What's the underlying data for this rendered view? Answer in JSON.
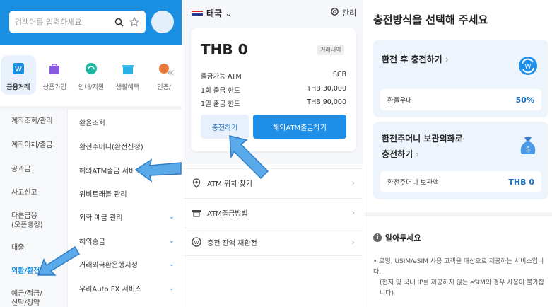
{
  "left": {
    "search_placeholder": "검색어를 입력하세요",
    "categories": [
      {
        "label": "금융거래",
        "icon": "finance-icon"
      },
      {
        "label": "상품가입",
        "icon": "bag-icon"
      },
      {
        "label": "안내/지원",
        "icon": "headset-icon"
      },
      {
        "label": "생활혜택",
        "icon": "gift-icon"
      },
      {
        "label": "인증/",
        "icon": "cert-icon"
      }
    ],
    "main_menu": [
      "계좌조회/관리",
      "계좌이체/출금",
      "공과금",
      "사고신고",
      "다른금융\n(오픈뱅킹)",
      "대출",
      "외환/환전",
      "예금/적금/\n신탁/청약"
    ],
    "sub_menu": [
      "환율조회",
      "환전주머니(환전신청)",
      "해외ATM출금 서비스",
      "위비트래블 관리",
      "외화 예금 관리",
      "해외송금",
      "거래외국환은행지정",
      "우리Auto FX 서비스"
    ]
  },
  "middle": {
    "country": "태국",
    "settings_label": "관리",
    "balance": "THB 0",
    "history_label": "거래내역",
    "rows": [
      {
        "label": "출금가능 ATM",
        "value": "SCB"
      },
      {
        "label": "1회 출금 한도",
        "value": "THB 30,000"
      },
      {
        "label": "1일 출금 한도",
        "value": "THB 90,000"
      }
    ],
    "charge_button": "충전하기",
    "withdraw_button": "해외ATM출금하기",
    "menu": [
      "ATM 위치 찾기",
      "ATM출금방법",
      "충전 잔액 재환전"
    ]
  },
  "right": {
    "title": "충전방식을 선택해 주세요",
    "option1_title": "환전 후 충전하기",
    "option1_label": "환율우대",
    "option1_value": "50%",
    "option2_title_line1": "환전주머니 보관외화로",
    "option2_title_line2": "충전하기",
    "option2_label": "환전주머니 보관액",
    "option2_value": "THB 0",
    "notice_title": "알아두세요",
    "notice_body": "로밍, USIM/eSIM 사용 고객을 대상으로 제공하는 서비스입니다.",
    "notice_sub": "(현지 및 국내 IP를 제공하지 않는 eSIM의 경우 사용이 불가합니다)"
  }
}
